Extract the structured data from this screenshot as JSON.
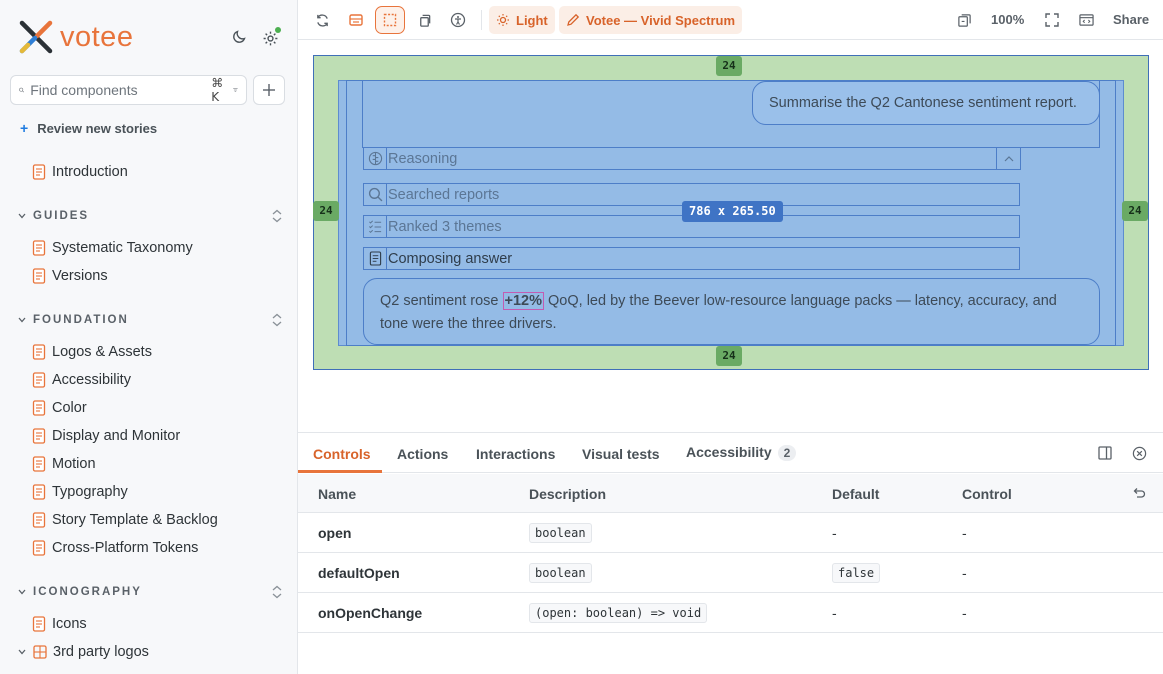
{
  "sidebar": {
    "brand": "votee",
    "search": {
      "placeholder": "Find components",
      "shortcut": "⌘ K"
    },
    "review_label": "Review new stories",
    "intro": "Introduction",
    "sections": [
      {
        "title": "GUIDES",
        "items": [
          "Systematic Taxonomy",
          "Versions"
        ]
      },
      {
        "title": "FOUNDATION",
        "items": [
          "Logos & Assets",
          "Accessibility",
          "Color",
          "Display and Monitor",
          "Motion",
          "Typography",
          "Story Template & Backlog",
          "Cross-Platform Tokens"
        ]
      },
      {
        "title": "ICONOGRAPHY",
        "items": [
          "Icons",
          "3rd party logos"
        ]
      }
    ]
  },
  "toolbar": {
    "theme_label": "Light",
    "brand_theme_label": "Votee — Vivid Spectrum",
    "zoom": "100%",
    "share_label": "Share"
  },
  "canvas": {
    "margin_top": "24",
    "margin_left": "24",
    "margin_right": "24",
    "margin_bottom": "24",
    "dimensions": "786 x 265.50",
    "user_message": "Summarise the Q2 Cantonese sentiment report.",
    "steps": [
      {
        "label": "Reasoning",
        "icon": "brain-icon"
      },
      {
        "label": "Searched reports",
        "icon": "search-icon"
      },
      {
        "label": "Ranked 3 themes",
        "icon": "list-check-icon"
      },
      {
        "label": "Composing answer",
        "icon": "document-icon"
      }
    ],
    "answer": {
      "before": "Q2 sentiment rose ",
      "highlight": "+12%",
      "after": " QoQ, led by the Beever low-resource language packs — latency, accuracy, and tone were the three drivers."
    }
  },
  "panel": {
    "tabs": [
      "Controls",
      "Actions",
      "Interactions",
      "Visual tests",
      "Accessibility"
    ],
    "accessibility_count": "2",
    "columns": [
      "Name",
      "Description",
      "Default",
      "Control"
    ],
    "rows": [
      {
        "name": "open",
        "description": "boolean",
        "default": "-",
        "control": "-"
      },
      {
        "name": "defaultOpen",
        "description": "boolean",
        "default": "false",
        "control": "-"
      },
      {
        "name": "onOpenChange",
        "description": "(open: boolean) => void",
        "default": "-",
        "control": "-"
      }
    ]
  },
  "colors": {
    "accent": "#e8743b",
    "margin_overlay": "#bedeb4",
    "content_overlay": "#94bbe6",
    "outline": "#3f6fb8"
  }
}
